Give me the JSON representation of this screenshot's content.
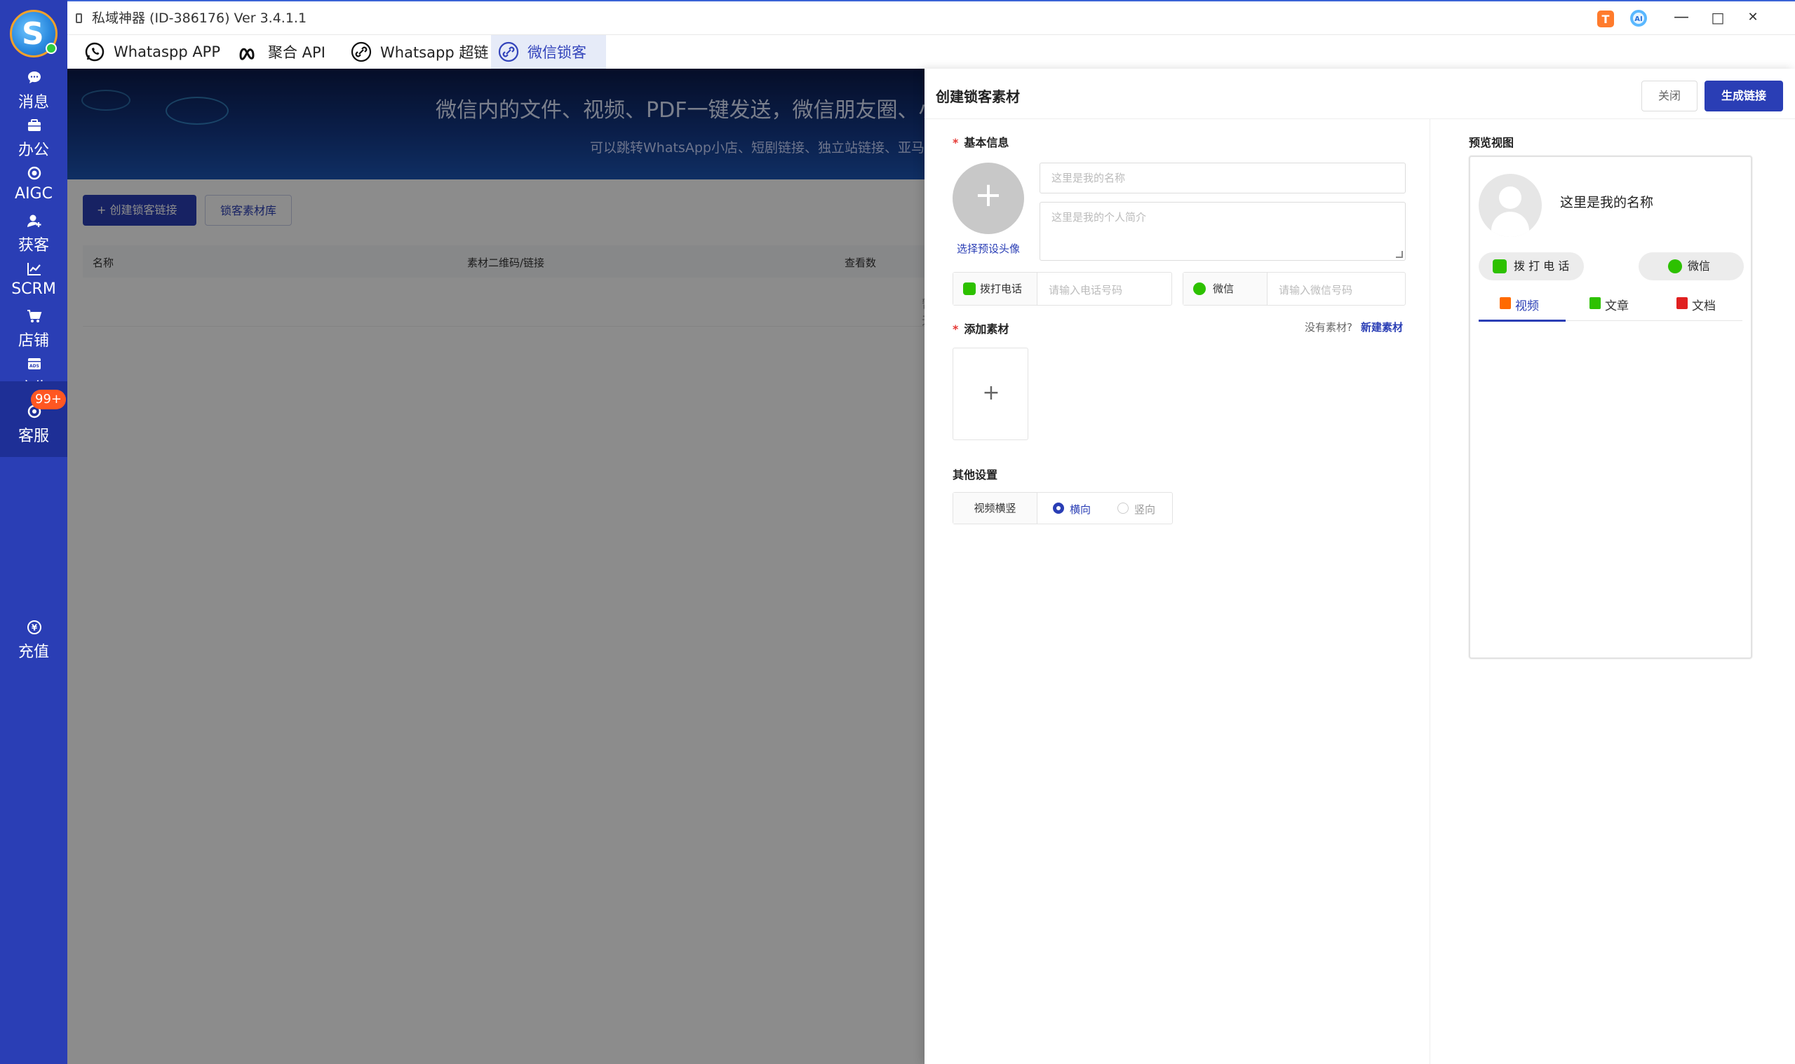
{
  "window": {
    "title": "私域神器 (ID-386176)  Ver 3.4.1.1",
    "controls": {
      "minimize": "—",
      "maximize": "□",
      "close": "✕"
    }
  },
  "sidebar": {
    "items": [
      {
        "label": "消息",
        "icon": "chat-bubble-icon"
      },
      {
        "label": "办公",
        "icon": "briefcase-icon"
      },
      {
        "label": "AIGC",
        "icon": "aigc-ring-icon"
      },
      {
        "label": "获客",
        "icon": "user-add-icon"
      },
      {
        "label": "SCRM",
        "icon": "trend-chart-icon"
      },
      {
        "label": "店铺",
        "icon": "cart-icon"
      },
      {
        "label": "广告",
        "icon": "ads-icon"
      },
      {
        "label": "客服",
        "icon": "customer-service-icon",
        "badge": "99+"
      }
    ],
    "bottom_item": {
      "label": "充值",
      "icon": "yen-coin-icon"
    }
  },
  "tabs": [
    {
      "label": "Whataspp APP",
      "icon": "whatsapp-icon"
    },
    {
      "label": "聚合 API",
      "icon": "meta-infinity-icon"
    },
    {
      "label": "Whatsapp 超链",
      "icon": "link-icon"
    },
    {
      "label": "微信锁客",
      "icon": "wechat-link-icon",
      "active": true
    }
  ],
  "background": {
    "banner_title": "微信内的文件、视频、PDF一键发送，微信朋友圈、小",
    "banner_subtitle": "可以跳转WhatsApp小店、短剧链接、独立站链接、亚马逊链",
    "create_button": "+ 创建锁客链接",
    "library_button": "锁客素材库",
    "table_headers": [
      "名称",
      "素材二维码/链接",
      "查看数"
    ],
    "empty_text": "暂无"
  },
  "drawer": {
    "title": "创建锁客素材",
    "close_label": "关闭",
    "generate_label": "生成链接",
    "basic_info_label": "基本信息",
    "avatar_pick_label": "选择预设头像",
    "name_placeholder": "这里是我的名称",
    "bio_placeholder": "这里是我的个人简介",
    "phone_label": "拨打电话",
    "phone_placeholder": "请输入电话号码",
    "wechat_label": "微信",
    "wechat_placeholder": "请输入微信号码",
    "add_material_label": "添加素材",
    "no_material_text": "没有素材?",
    "new_material_link": "新建素材",
    "other_settings_label": "其他设置",
    "orientation_label": "视频横竖",
    "orientation_options": [
      "横向",
      "竖向"
    ],
    "orientation_selected": "横向"
  },
  "preview": {
    "title": "预览视图",
    "name": "这里是我的名称",
    "call_button": "拨 打 电 话",
    "wechat_button": "微信",
    "tabs": [
      "视频",
      "文章",
      "文档"
    ],
    "active_tab": "视频"
  },
  "colors": {
    "primary": "#2a3eb5",
    "sidebar_bg": "#2a3eb5",
    "badge": "#ff5722",
    "required": "#e53935",
    "wechat_green": "#2dc100",
    "video_orange": "#ff6a00",
    "doc_red": "#e02020"
  }
}
